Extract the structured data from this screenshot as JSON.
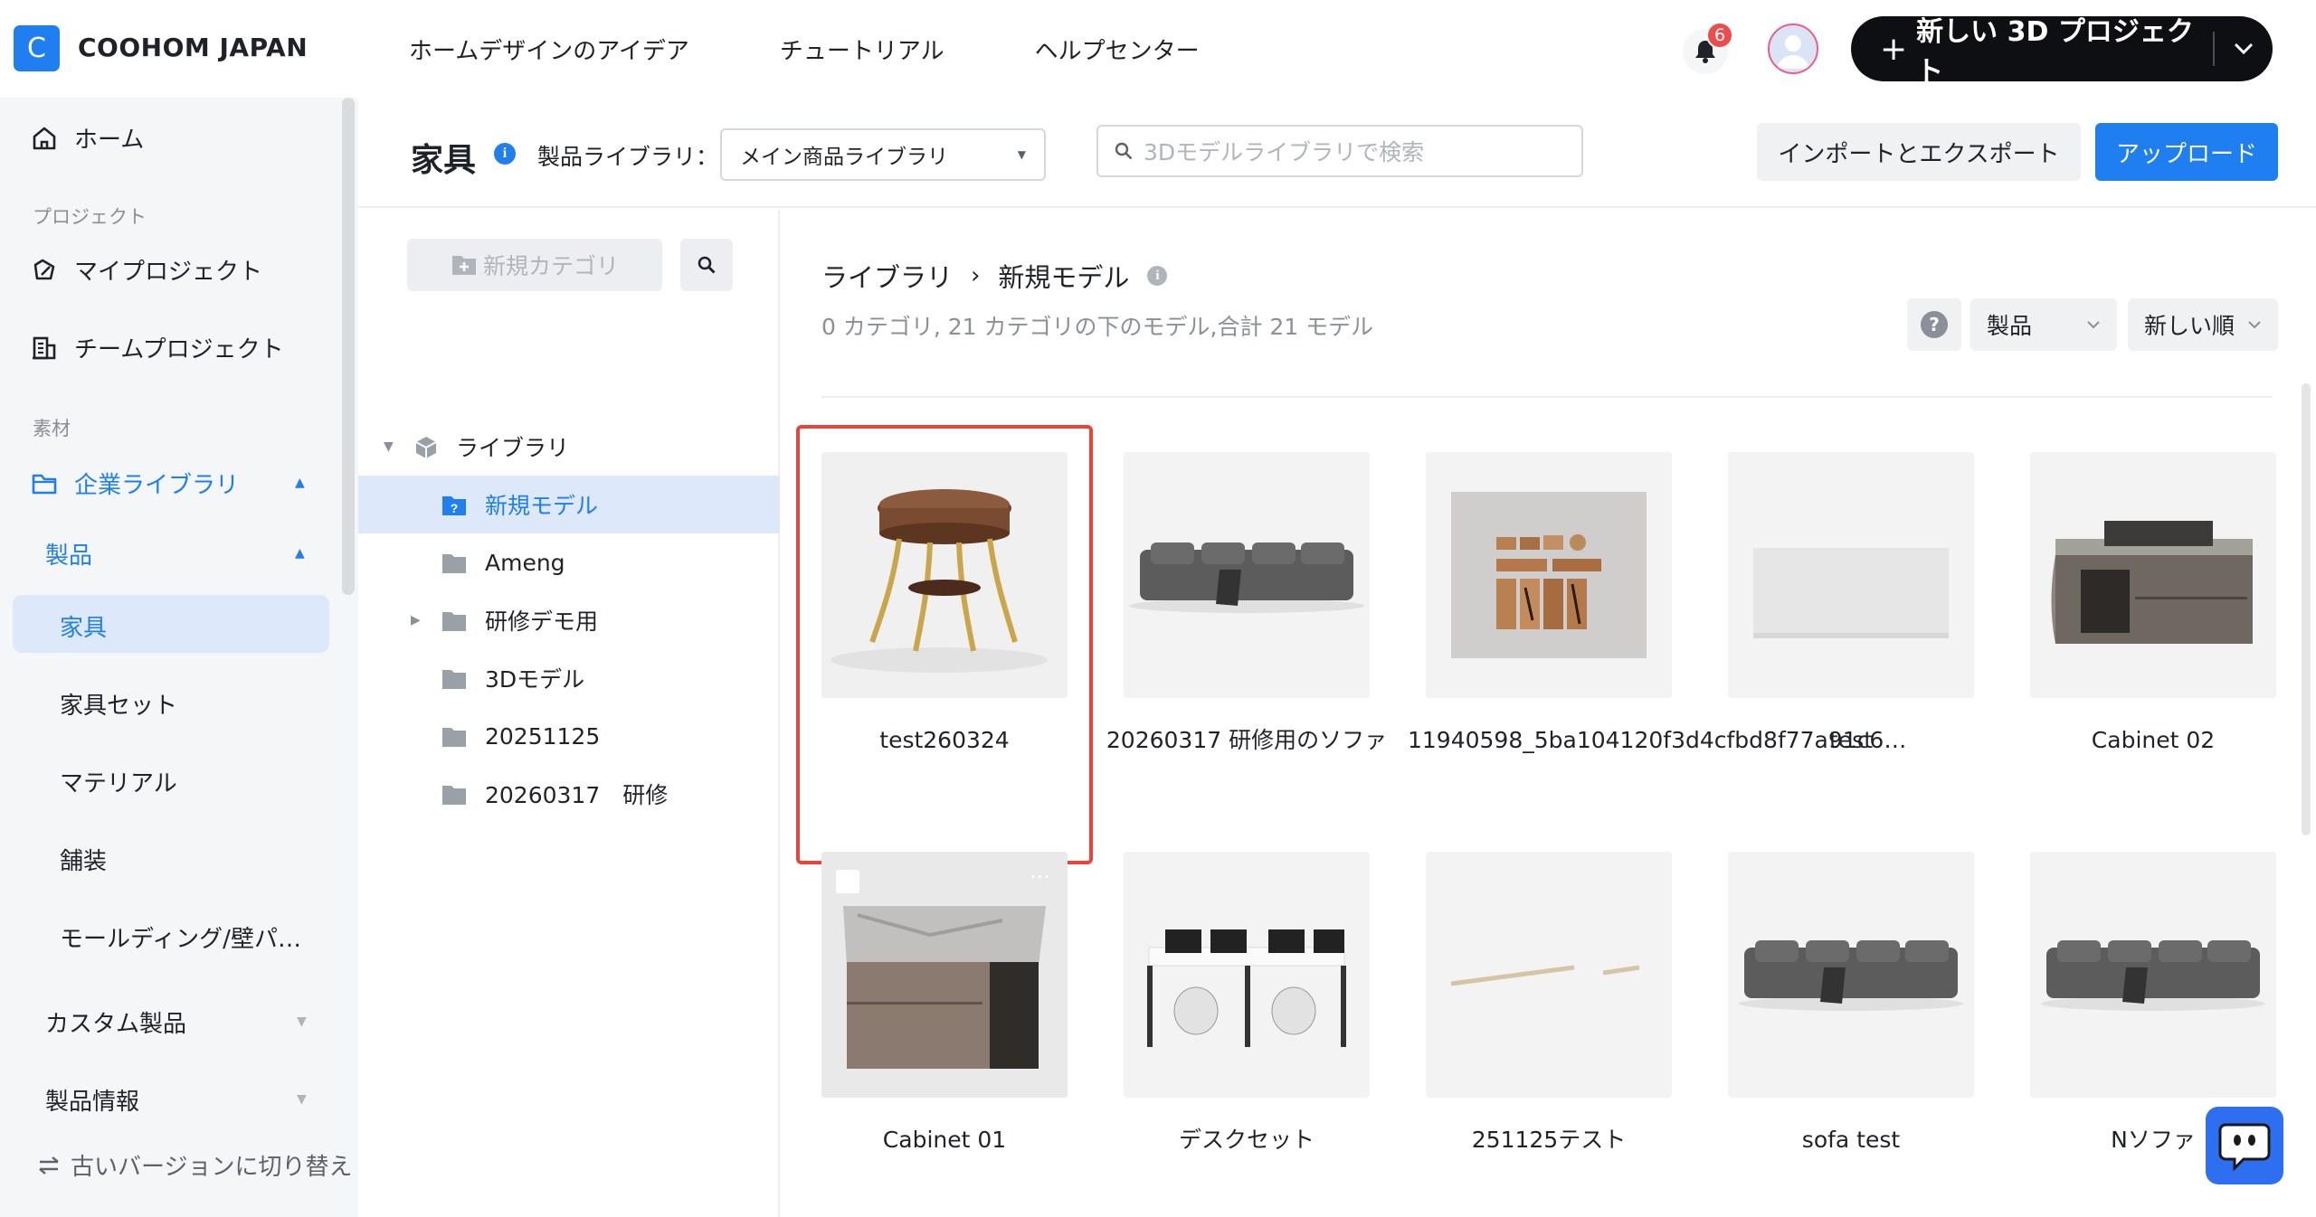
{
  "header": {
    "logo_letter": "C",
    "brand": "COOHOM JAPAN",
    "nav": [
      "ホームデザインのアイデア",
      "チュートリアル",
      "ヘルプセンター"
    ],
    "notification_count": "6",
    "new_project_label": "新しい 3D プロジェクト",
    "accent_color": "#1f7ff0"
  },
  "sidebar": {
    "home": "ホーム",
    "section_project": "プロジェクト",
    "my_project": "マイプロジェクト",
    "team_project": "チームプロジェクト",
    "section_material": "素材",
    "enterprise_library": "企業ライブラリ",
    "products": "製品",
    "sub_items": [
      "家具",
      "家具セット",
      "マテリアル",
      "舗装",
      "モールディング/壁パ…"
    ],
    "custom_products": "カスタム製品",
    "product_info": "製品情報",
    "switch_old": "古いバージョンに切り替え"
  },
  "page": {
    "title": "家具",
    "library_label": "製品ライブラリ：",
    "library_selected": "メイン商品ライブラリ",
    "search_placeholder": "3Dモデルライブラリで検索",
    "import_export": "インポートとエクスポート",
    "upload": "アップロード"
  },
  "tree": {
    "new_category": "新規カテゴリ",
    "root": "ライブラリ",
    "items": [
      "新規モデル",
      "Ameng",
      "研修デモ用",
      "3Dモデル",
      "20251125",
      "20260317　研修"
    ]
  },
  "content": {
    "breadcrumb": [
      "ライブラリ",
      "新規モデル"
    ],
    "summary": "0 カテゴリ, 21 カテゴリの下のモデル,合計 21 モデル",
    "filter_product": "製品",
    "sort": "新しい順",
    "models": [
      "test260324",
      "20260317 研修用のソファ",
      "11940598_5ba104120f3d4cfbd8f77a91c6…",
      "test",
      "Cabinet 02",
      "Cabinet 01",
      "デスクセット",
      "251125テスト",
      "sofa test",
      "Nソファ"
    ]
  }
}
